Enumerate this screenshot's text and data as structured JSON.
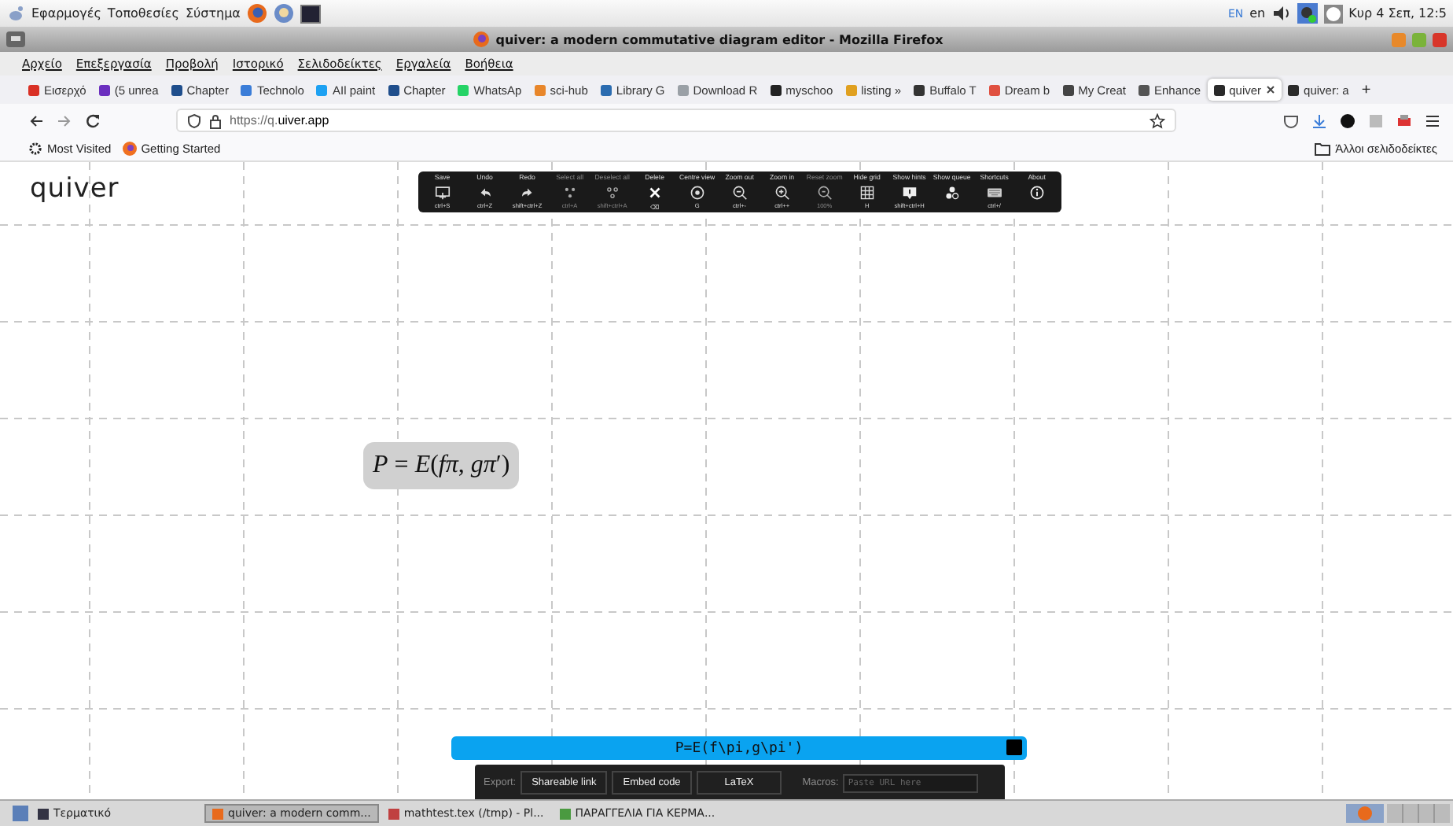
{
  "top_panel": {
    "menus": [
      "Εφαρμογές",
      "Τοποθεσίες",
      "Σύστημα"
    ],
    "keyboard": "EN",
    "language": "en",
    "clock": "Κυρ  4 Σεπ, 12:5"
  },
  "window": {
    "title": "quiver: a modern commutative diagram editor - Mozilla Firefox"
  },
  "menu_bar": [
    "Αρχείο",
    "Επεξεργασία",
    "Προβολή",
    "Ιστορικό",
    "Σελιδοδείκτες",
    "Εργαλεία",
    "Βοήθεια"
  ],
  "tabs": [
    {
      "label": "Εισερχό",
      "color": "#d93025",
      "selected": false
    },
    {
      "label": "(5 unrea",
      "color": "#6b2fbf",
      "selected": false
    },
    {
      "label": "Chapter",
      "color": "#1f4e8c",
      "selected": false
    },
    {
      "label": "Technolo",
      "color": "#3b7dd8",
      "selected": false
    },
    {
      "label": "AIl paint",
      "color": "#1da1f2",
      "selected": false
    },
    {
      "label": "Chapter",
      "color": "#1f4e8c",
      "selected": false
    },
    {
      "label": "WhatsAp",
      "color": "#25d366",
      "selected": false
    },
    {
      "label": "sci-hub",
      "color": "#e8862a",
      "selected": false
    },
    {
      "label": "Library G",
      "color": "#2b6cb0",
      "selected": false
    },
    {
      "label": "Download R",
      "color": "#9aa0a6",
      "selected": false
    },
    {
      "label": "myschoo",
      "color": "#222222",
      "selected": false
    },
    {
      "label": "listing »",
      "color": "#e0a020",
      "selected": false
    },
    {
      "label": "Buffalo T",
      "color": "#333333",
      "selected": false
    },
    {
      "label": "Dream b",
      "color": "#e05040",
      "selected": false
    },
    {
      "label": "My Creat",
      "color": "#444444",
      "selected": false
    },
    {
      "label": "Enhance",
      "color": "#555555",
      "selected": false
    },
    {
      "label": "quiver",
      "color": "#2a2a2a",
      "selected": true
    },
    {
      "label": "quiver: a",
      "color": "#2a2a2a",
      "selected": false
    }
  ],
  "new_tab": "+",
  "address_bar": {
    "prefix": "https://q.",
    "domain": "uiver.app"
  },
  "bookmarks": [
    "Most Visited",
    "Getting Started"
  ],
  "other_bookmarks": "Άλλοι σελιδοδείκτες",
  "app": {
    "logo": "quiver",
    "toolbar": [
      {
        "label": "Save",
        "shortcut": "ctrl+S",
        "disabled": false
      },
      {
        "label": "Undo",
        "shortcut": "ctrl+Z",
        "disabled": false
      },
      {
        "label": "Redo",
        "shortcut": "shift+ctrl+Z",
        "disabled": false
      },
      {
        "label": "Select all",
        "shortcut": "ctrl+A",
        "disabled": true
      },
      {
        "label": "Deselect all",
        "shortcut": "shift+ctrl+A",
        "disabled": true
      },
      {
        "label": "Delete",
        "shortcut": "⌫",
        "disabled": false
      },
      {
        "label": "Centre view",
        "shortcut": "G",
        "disabled": false
      },
      {
        "label": "Zoom out",
        "shortcut": "ctrl+-",
        "disabled": false
      },
      {
        "label": "Zoom in",
        "shortcut": "ctrl++",
        "disabled": false
      },
      {
        "label": "Reset zoom",
        "shortcut": "100%",
        "disabled": true
      },
      {
        "label": "Hide grid",
        "shortcut": "H",
        "disabled": false
      },
      {
        "label": "Show hints",
        "shortcut": "shift+ctrl+H",
        "disabled": false
      },
      {
        "label": "Show queue",
        "disabled": false
      },
      {
        "label": "Shortcuts",
        "shortcut": "ctrl+/",
        "disabled": false
      },
      {
        "label": "About",
        "disabled": false
      }
    ],
    "cell": "*P* = *E*(*fπ*, *gπ*′)",
    "label_input": "P=E(f\\pi,g\\pi')",
    "export": {
      "label": "Export:",
      "buttons": [
        "Shareable link",
        "Embed code",
        "LaTeX"
      ],
      "macros_label": "Macros:",
      "macros_placeholder": "Paste URL here"
    }
  },
  "taskbar": [
    {
      "label": "Τερματικό",
      "selected": false
    },
    {
      "label": "quiver: a modern comm...",
      "selected": true
    },
    {
      "label": "mathtest.tex (/tmp) - Pl...",
      "selected": false
    },
    {
      "label": "ΠΑΡΑΓΓΕΛΙΑ ΓΙΑ ΚΕΡΜΑ...",
      "selected": false
    }
  ]
}
